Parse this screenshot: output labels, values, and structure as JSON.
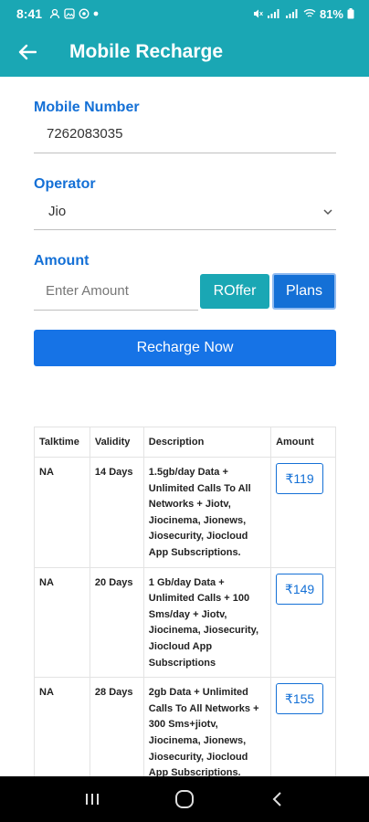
{
  "status_bar": {
    "time": "8:41",
    "battery": "81%"
  },
  "app_bar": {
    "title": "Mobile Recharge"
  },
  "form": {
    "mobile_label": "Mobile Number",
    "mobile_value": "7262083035",
    "operator_label": "Operator",
    "operator_value": "Jio",
    "amount_label": "Amount",
    "amount_placeholder": "Enter Amount",
    "roffer_label": "ROffer",
    "plans_label": "Plans",
    "recharge_label": "Recharge Now"
  },
  "plans_table": {
    "headers": [
      "Talktime",
      "Validity",
      "Description",
      "Amount"
    ],
    "rows": [
      {
        "talktime": "NA",
        "validity": "14 Days",
        "description": "1.5gb/day Data + Unlimited Calls To All Networks + Jiotv, Jiocinema, Jionews, Jiosecurity, Jiocloud App Subscriptions.",
        "amount": "₹119"
      },
      {
        "talktime": "NA",
        "validity": "20 Days",
        "description": "1 Gb/day Data + Unlimited Calls + 100 Sms/day + Jiotv, Jiocinema, Jiosecurity, Jiocloud App Subscriptions",
        "amount": "₹149"
      },
      {
        "talktime": "NA",
        "validity": "28 Days",
        "description": "2gb Data + Unlimited Calls To All Networks + 300 Sms+jiotv, Jiocinema, Jionews, Jiosecurity, Jiocloud App Subscriptions.",
        "amount": "₹155"
      }
    ]
  },
  "colors": {
    "primary_teal": "#1aa7b4",
    "primary_blue": "#1470d6",
    "recharge_blue": "#1673e6"
  },
  "icons": {
    "back": "arrow-left-icon",
    "dropdown": "chevron-down-icon",
    "nav_recents": "recents-icon",
    "nav_home": "home-icon",
    "nav_back": "nav-back-icon"
  }
}
